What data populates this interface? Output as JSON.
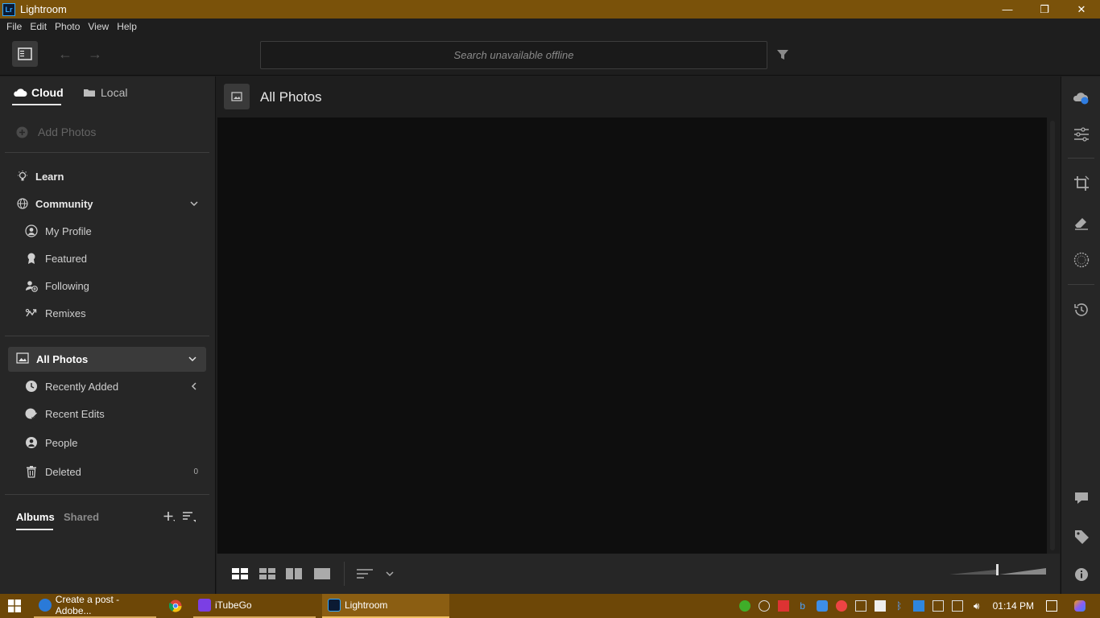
{
  "window": {
    "title": "Lightroom",
    "app_icon": "Lr",
    "minimize": "—",
    "restore": "❐",
    "close": "✕"
  },
  "menu": [
    "File",
    "Edit",
    "Photo",
    "View",
    "Help"
  ],
  "toolbar": {
    "search_placeholder": "Search unavailable offline"
  },
  "left_panel": {
    "tabs": {
      "cloud": "Cloud",
      "local": "Local"
    },
    "add_photos": "Add Photos",
    "learn": "Learn",
    "community": {
      "label": "Community",
      "items": [
        "My Profile",
        "Featured",
        "Following",
        "Remixes"
      ]
    },
    "all_photos": {
      "label": "All Photos",
      "items": [
        {
          "label": "Recently Added",
          "count": ""
        },
        {
          "label": "Recent Edits",
          "count": ""
        },
        {
          "label": "People",
          "count": ""
        },
        {
          "label": "Deleted",
          "count": "0"
        }
      ]
    },
    "albums_tabs": {
      "albums": "Albums",
      "shared": "Shared"
    }
  },
  "main": {
    "title": "All Photos"
  },
  "taskbar": {
    "items": [
      {
        "label": "Create a post - Adobe...",
        "icon": "edge-icon"
      },
      {
        "label": "",
        "icon": "chrome-icon"
      },
      {
        "label": "iTubeGo",
        "icon": "itubego-icon"
      },
      {
        "label": "Lightroom",
        "icon": "lightroom-icon"
      }
    ],
    "clock": "01:14 PM"
  },
  "colors": {
    "titlebar": "#7a520a",
    "taskbar": "#6d4707",
    "panel": "#262626",
    "grid": "#0e0e0e",
    "accent": "#31a8ff"
  }
}
